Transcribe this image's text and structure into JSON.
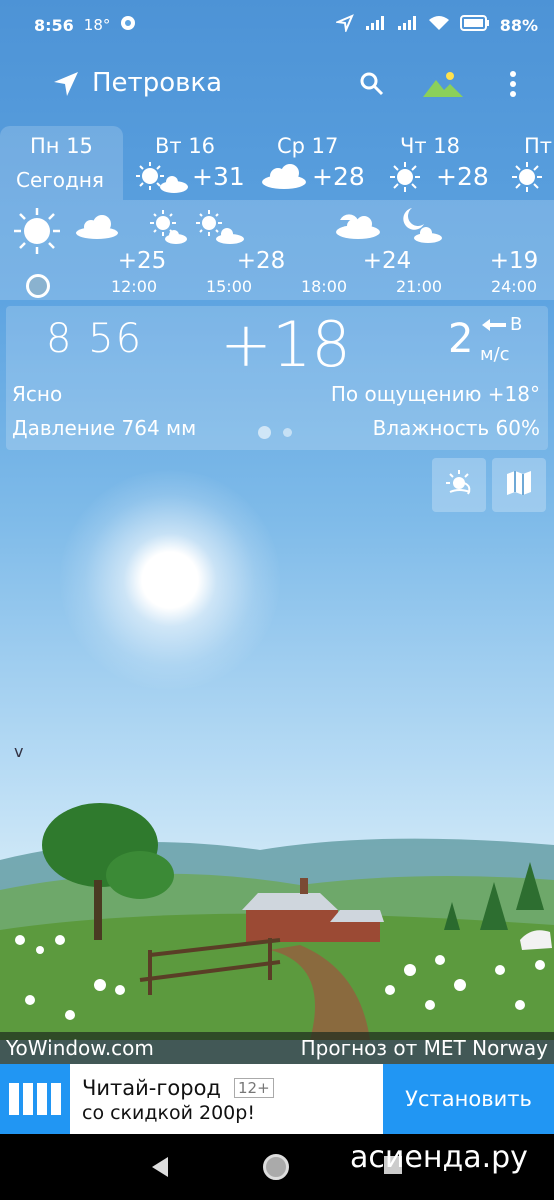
{
  "status_bar": {
    "time": "8:56",
    "temp": "18°",
    "battery": "88%"
  },
  "header": {
    "location": "Петровка"
  },
  "days": [
    {
      "name": "Пн 15",
      "sub": "Сегодня"
    },
    {
      "name": "Вт 16",
      "temp": "+31"
    },
    {
      "name": "Ср 17",
      "temp": "+28"
    },
    {
      "name": "Чт 18",
      "temp": "+28"
    },
    {
      "name": "Пт"
    }
  ],
  "hourly": [
    {
      "time": "12:00",
      "temp": "+25"
    },
    {
      "time": "15:00",
      "temp": "+28"
    },
    {
      "time": "18:00",
      "temp": ""
    },
    {
      "time": "21:00",
      "temp": "+24"
    },
    {
      "time": "24:00",
      "temp": "+19"
    }
  ],
  "current": {
    "clock": "8 56",
    "temp": "+18",
    "wind_speed": "2",
    "wind_dir": "В",
    "wind_unit": "м/с",
    "condition": "Ясно",
    "feels_like": "По ощущению +18°",
    "pressure": "Давление 764 мм",
    "humidity": "Влажность 60%"
  },
  "credits": {
    "left": "YoWindow.com",
    "right": "Прогноз от MET Norway"
  },
  "ad": {
    "title": "Читай-город",
    "age": "12+",
    "subtitle": "со скидкой 200р!",
    "button": "Установить"
  },
  "watermark": "асиенда.ру",
  "colors": {
    "sky": "#5ea4e1",
    "accent": "#2196f3"
  }
}
